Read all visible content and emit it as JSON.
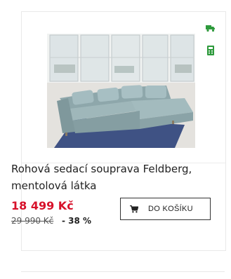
{
  "product": {
    "name": "Rohová sedací souprava Feldberg, mentolová látka",
    "price": "18 499 Kč",
    "old_price": "29 990 Kč",
    "discount": "- 38 %",
    "cart_button_label": "DO KOŠÍKU"
  },
  "icons": {
    "delivery": "truck-icon",
    "installments": "calculator-icon",
    "cart": "shopping-cart-icon"
  },
  "colors": {
    "price": "#d7112a",
    "icon_green": "#2e9a3c",
    "upholstery": "#9fb7ba",
    "rug": "#3f5284"
  }
}
